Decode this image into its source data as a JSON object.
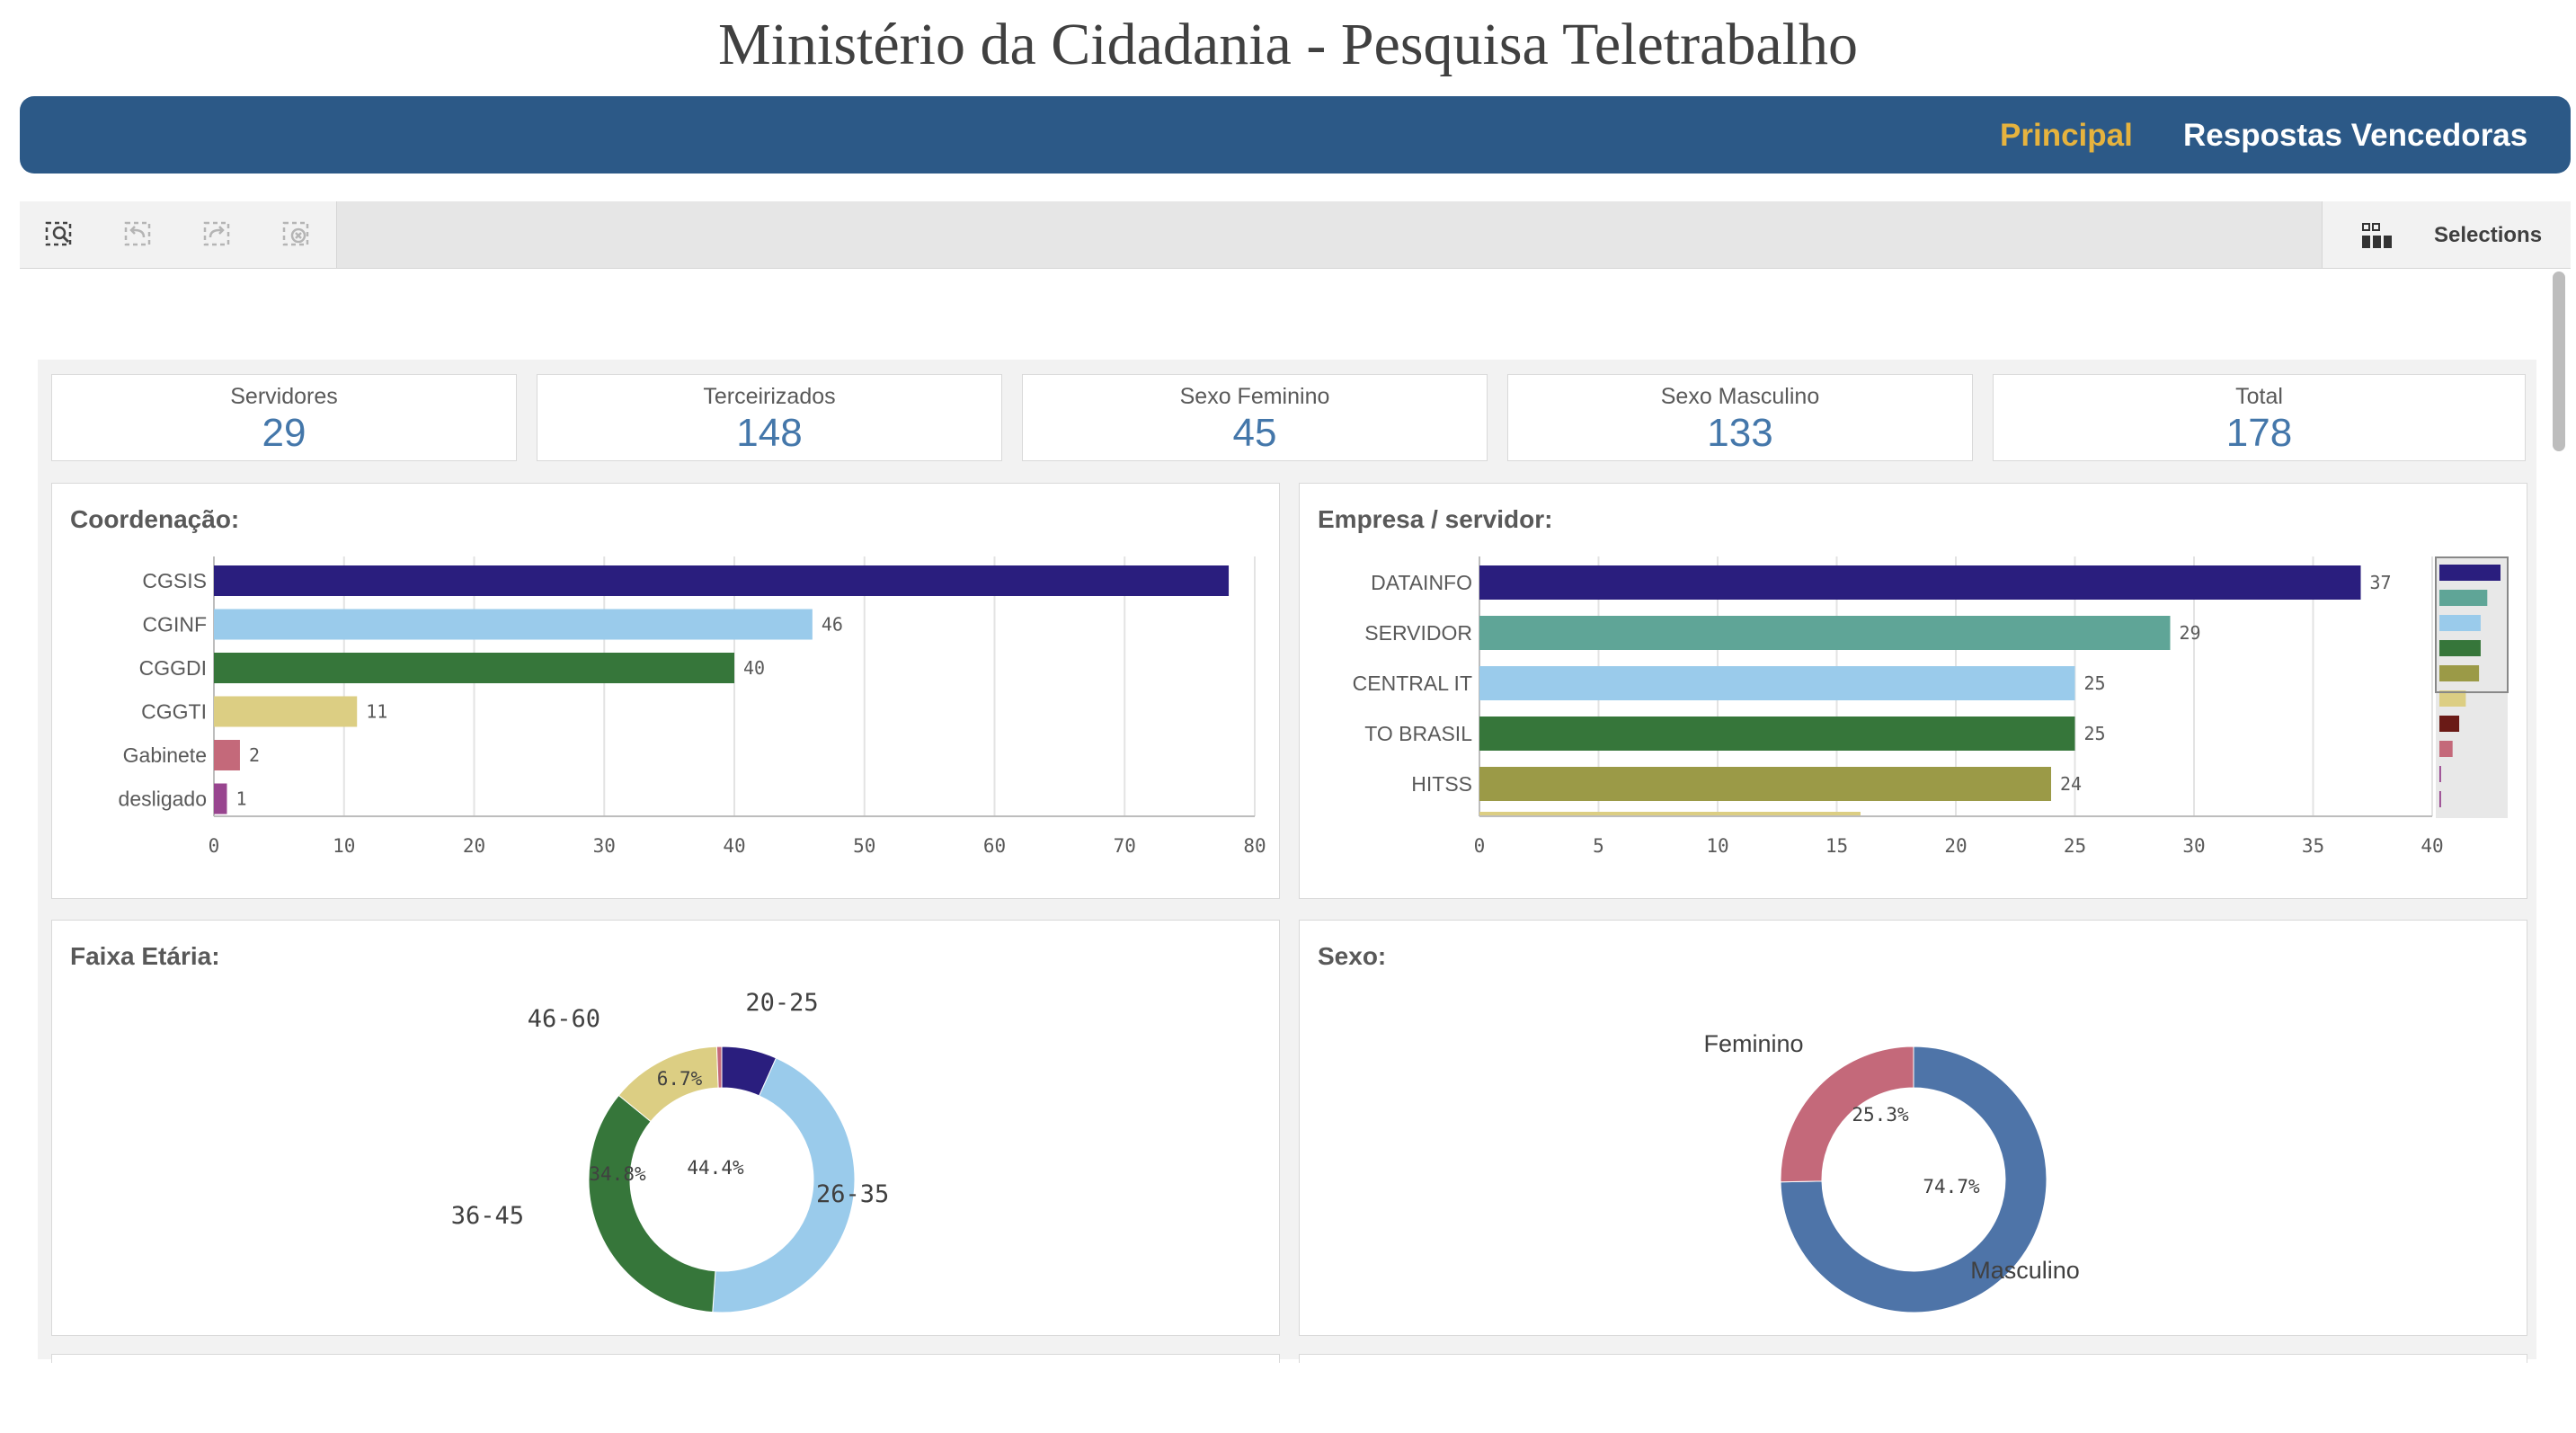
{
  "header": {
    "title": "Ministério da Cidadania - Pesquisa Teletrabalho",
    "nav": [
      {
        "label": "Principal",
        "color": "#e6b33e"
      },
      {
        "label": "Respostas Vencedoras",
        "color": "#ffffff"
      }
    ]
  },
  "toolbar": {
    "buttons": [
      "smart-search-icon",
      "step-back-icon",
      "step-forward-icon",
      "clear-selections-icon"
    ],
    "selections_label": "Selections"
  },
  "kpis": [
    {
      "label": "Servidores",
      "value": "29"
    },
    {
      "label": "Terceirizados",
      "value": "148"
    },
    {
      "label": "Sexo Feminino",
      "value": "45"
    },
    {
      "label": "Sexo Masculino",
      "value": "133"
    },
    {
      "label": "Total",
      "value": "178"
    }
  ],
  "chart_data": [
    {
      "type": "bar",
      "orientation": "horizontal",
      "title": "Coordenação:",
      "categories": [
        "CGSIS",
        "CGINF",
        "CGGDI",
        "CGGTI",
        "Gabinete",
        "desligado"
      ],
      "values": [
        78,
        46,
        40,
        11,
        2,
        1
      ],
      "data_labels": [
        "",
        "46",
        "40",
        "11",
        "2",
        "1"
      ],
      "colors": [
        "#2a1e7e",
        "#9acbeb",
        "#36763a",
        "#dcce83",
        "#c4697a",
        "#98458f"
      ],
      "xlim": [
        0,
        80
      ],
      "xticks": [
        "0",
        "10",
        "20",
        "30",
        "40",
        "50",
        "60",
        "70",
        "80"
      ],
      "grid": true
    },
    {
      "type": "bar",
      "orientation": "horizontal",
      "title": "Empresa / servidor:",
      "categories": [
        "DATAINFO",
        "SERVIDOR",
        "CENTRAL IT",
        "TO BRASIL",
        "HITSS"
      ],
      "values": [
        37,
        29,
        25,
        25,
        24
      ],
      "data_labels": [
        "37",
        "29",
        "25",
        "25",
        "24"
      ],
      "partial_next_value": 16,
      "colors": [
        "#2a1e7e",
        "#5fa597",
        "#9acbeb",
        "#36763a",
        "#9b9a47"
      ],
      "xlim": [
        0,
        40
      ],
      "xticks": [
        "0",
        "5",
        "10",
        "15",
        "20",
        "25",
        "30",
        "35",
        "40"
      ],
      "grid": true,
      "minichart": {
        "values": [
          37,
          29,
          25,
          25,
          24,
          16,
          12,
          8,
          1,
          1
        ],
        "colors": [
          "#2a1e7e",
          "#5fa597",
          "#9acbeb",
          "#36763a",
          "#9b9a47",
          "#dcce83",
          "#6a1a16",
          "#c4697a",
          "#98458f",
          "#98458f"
        ]
      }
    },
    {
      "type": "pie",
      "donut": true,
      "title": "Faixa Etária:",
      "slices": [
        {
          "label": "20-25",
          "value": 6.7,
          "pct_label": "6.7%",
          "color": "#2a1e7e"
        },
        {
          "label": "26-35",
          "value": 44.4,
          "pct_label": "44.4%",
          "color": "#9acbeb"
        },
        {
          "label": "36-45",
          "value": 34.8,
          "pct_label": "34.8%",
          "color": "#36763a"
        },
        {
          "label": "46-60",
          "value": 13.5,
          "pct_label": "",
          "color": "#dcce83"
        },
        {
          "label": "",
          "value": 0.6,
          "pct_label": "",
          "color": "#c4697a"
        }
      ]
    },
    {
      "type": "pie",
      "donut": true,
      "title": "Sexo:",
      "slices": [
        {
          "label": "Masculino",
          "value": 74.7,
          "pct_label": "74.7%",
          "color": "#4e74a8"
        },
        {
          "label": "Feminino",
          "value": 25.3,
          "pct_label": "25.3%",
          "color": "#c4697a"
        }
      ]
    }
  ]
}
